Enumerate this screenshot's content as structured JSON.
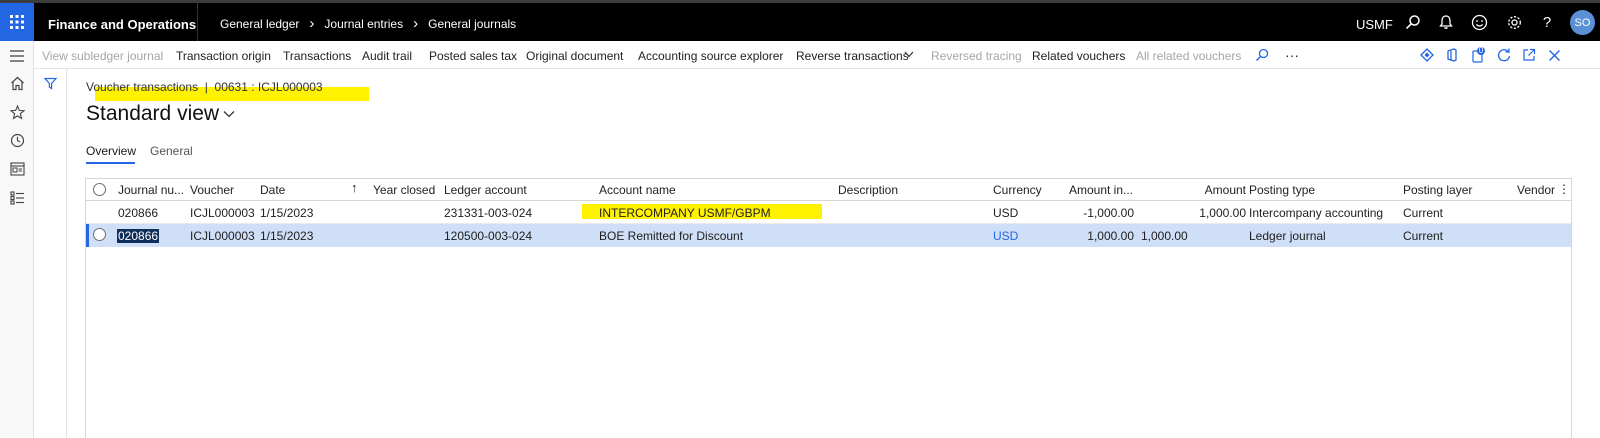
{
  "header": {
    "app_name": "Finance and Operations",
    "breadcrumbs": [
      "General ledger",
      "Journal entries",
      "General journals"
    ],
    "company": "USMF",
    "avatar_initials": "SO",
    "brand_color": "#2266e3"
  },
  "actions": {
    "view_subledger_journal": "View subledger journal",
    "transaction_origin": "Transaction origin",
    "transactions": "Transactions",
    "audit_trail": "Audit trail",
    "posted_sales_tax": "Posted sales tax",
    "original_document": "Original document",
    "accounting_source_explorer": "Accounting source explorer",
    "reverse_transactions": "Reverse transactions",
    "reversed_tracing": "Reversed tracing",
    "related_vouchers": "Related vouchers",
    "all_related_vouchers": "All related vouchers",
    "more": "···",
    "attachments_count": "0"
  },
  "page": {
    "caption": "Voucher transactions  |  00631 : ICJL000003",
    "view_title": "Standard view"
  },
  "tabs": [
    {
      "label": "Overview",
      "active": true
    },
    {
      "label": "General",
      "active": false
    }
  ],
  "grid": {
    "columns": {
      "journal_number": "Journal nu...",
      "voucher": "Voucher",
      "date": "Date",
      "year_closed": "Year closed",
      "ledger_account": "Ledger account",
      "account_name": "Account name",
      "description": "Description",
      "currency": "Currency",
      "amount_in": "Amount in...",
      "amount": "Amount",
      "posting_type": "Posting type",
      "posting_layer": "Posting layer",
      "vendor": "Vendor"
    },
    "rows": [
      {
        "journal_number": "020866",
        "voucher": "ICJL000003",
        "date": "1/15/2023",
        "ledger_account": "231331-003-024",
        "account_name": "INTERCOMPANY USMF/GBPM",
        "currency": "USD",
        "amount_in": "-1,000.00",
        "amount": "1,000.00",
        "posting_type": "Intercompany accounting",
        "posting_layer": "Current"
      },
      {
        "journal_number": "020866",
        "voucher": "ICJL000003",
        "date": "1/15/2023",
        "ledger_account": "120500-003-024",
        "account_name": "BOE Remitted for Discount",
        "currency": "USD",
        "amount_in": "1,000.00",
        "amount_extra": "1,000.00",
        "posting_type": "Ledger journal",
        "posting_layer": "Current"
      }
    ]
  }
}
